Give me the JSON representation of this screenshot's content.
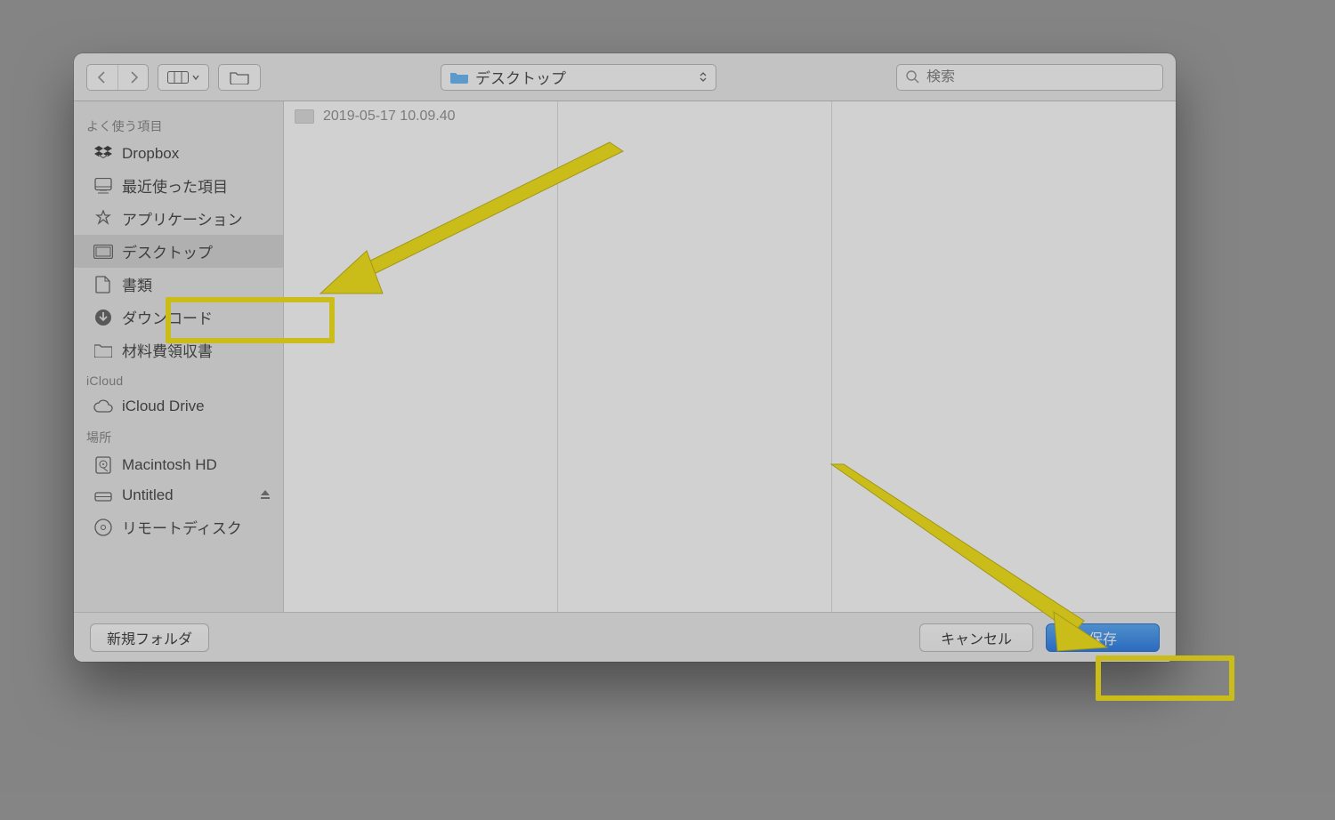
{
  "toolbar": {
    "path_label": "デスクトップ",
    "search_placeholder": "検索"
  },
  "sidebar": {
    "sections": [
      {
        "title": "よく使う項目",
        "items": [
          {
            "icon": "dropbox",
            "label": "Dropbox"
          },
          {
            "icon": "recents",
            "label": "最近使った項目"
          },
          {
            "icon": "apps",
            "label": "アプリケーション"
          },
          {
            "icon": "desktop",
            "label": "デスクトップ",
            "selected": true
          },
          {
            "icon": "documents",
            "label": "書類"
          },
          {
            "icon": "downloads",
            "label": "ダウンロード"
          },
          {
            "icon": "folder",
            "label": "材料費領収書"
          }
        ]
      },
      {
        "title": "iCloud",
        "items": [
          {
            "icon": "icloud",
            "label": "iCloud Drive"
          }
        ]
      },
      {
        "title": "場所",
        "items": [
          {
            "icon": "hdd",
            "label": "Macintosh HD"
          },
          {
            "icon": "hdd",
            "label": "Untitled",
            "eject": true
          },
          {
            "icon": "disc",
            "label": "リモートディスク"
          }
        ]
      }
    ]
  },
  "files": {
    "col1": [
      {
        "name": "2019-05-17 10.09.40"
      }
    ]
  },
  "footer": {
    "new_folder": "新規フォルダ",
    "cancel": "キャンセル",
    "save": "保存"
  }
}
